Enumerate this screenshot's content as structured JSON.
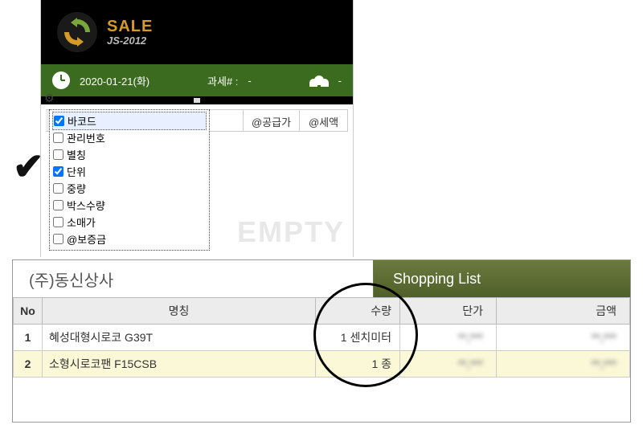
{
  "brand": {
    "name": "SALE",
    "sub": "JS-2012"
  },
  "status": {
    "date": "2020-01-21(화)",
    "tax_label": "과세# :",
    "tax_value": "-",
    "people_value": "-"
  },
  "columns": {
    "supply": "@공급가",
    "tax": "@세액"
  },
  "checkbox_popup": {
    "items": [
      {
        "label": "바코드",
        "checked": true
      },
      {
        "label": "관리번호",
        "checked": false
      },
      {
        "label": "별칭",
        "checked": false
      },
      {
        "label": "단위",
        "checked": true
      },
      {
        "label": "중량",
        "checked": false
      },
      {
        "label": "박스수량",
        "checked": false
      },
      {
        "label": "소매가",
        "checked": false
      },
      {
        "label": "@보증금",
        "checked": false
      }
    ]
  },
  "watermark": "EMPTY",
  "shop": {
    "company": "(주)동신상사",
    "tab": "Shopping List",
    "headers": {
      "no": "No",
      "name": "명칭",
      "qty": "수량",
      "unit": "단가",
      "amt": "금액"
    },
    "rows": [
      {
        "no": "1",
        "name": "혜성대형시로코 G39T",
        "qty": "1 센치미터",
        "unit": "**,***",
        "amt": "**,***"
      },
      {
        "no": "2",
        "name": "소형시로코팬 F15CSB",
        "qty": "1 종",
        "unit": "**,***",
        "amt": "**,***"
      }
    ]
  }
}
